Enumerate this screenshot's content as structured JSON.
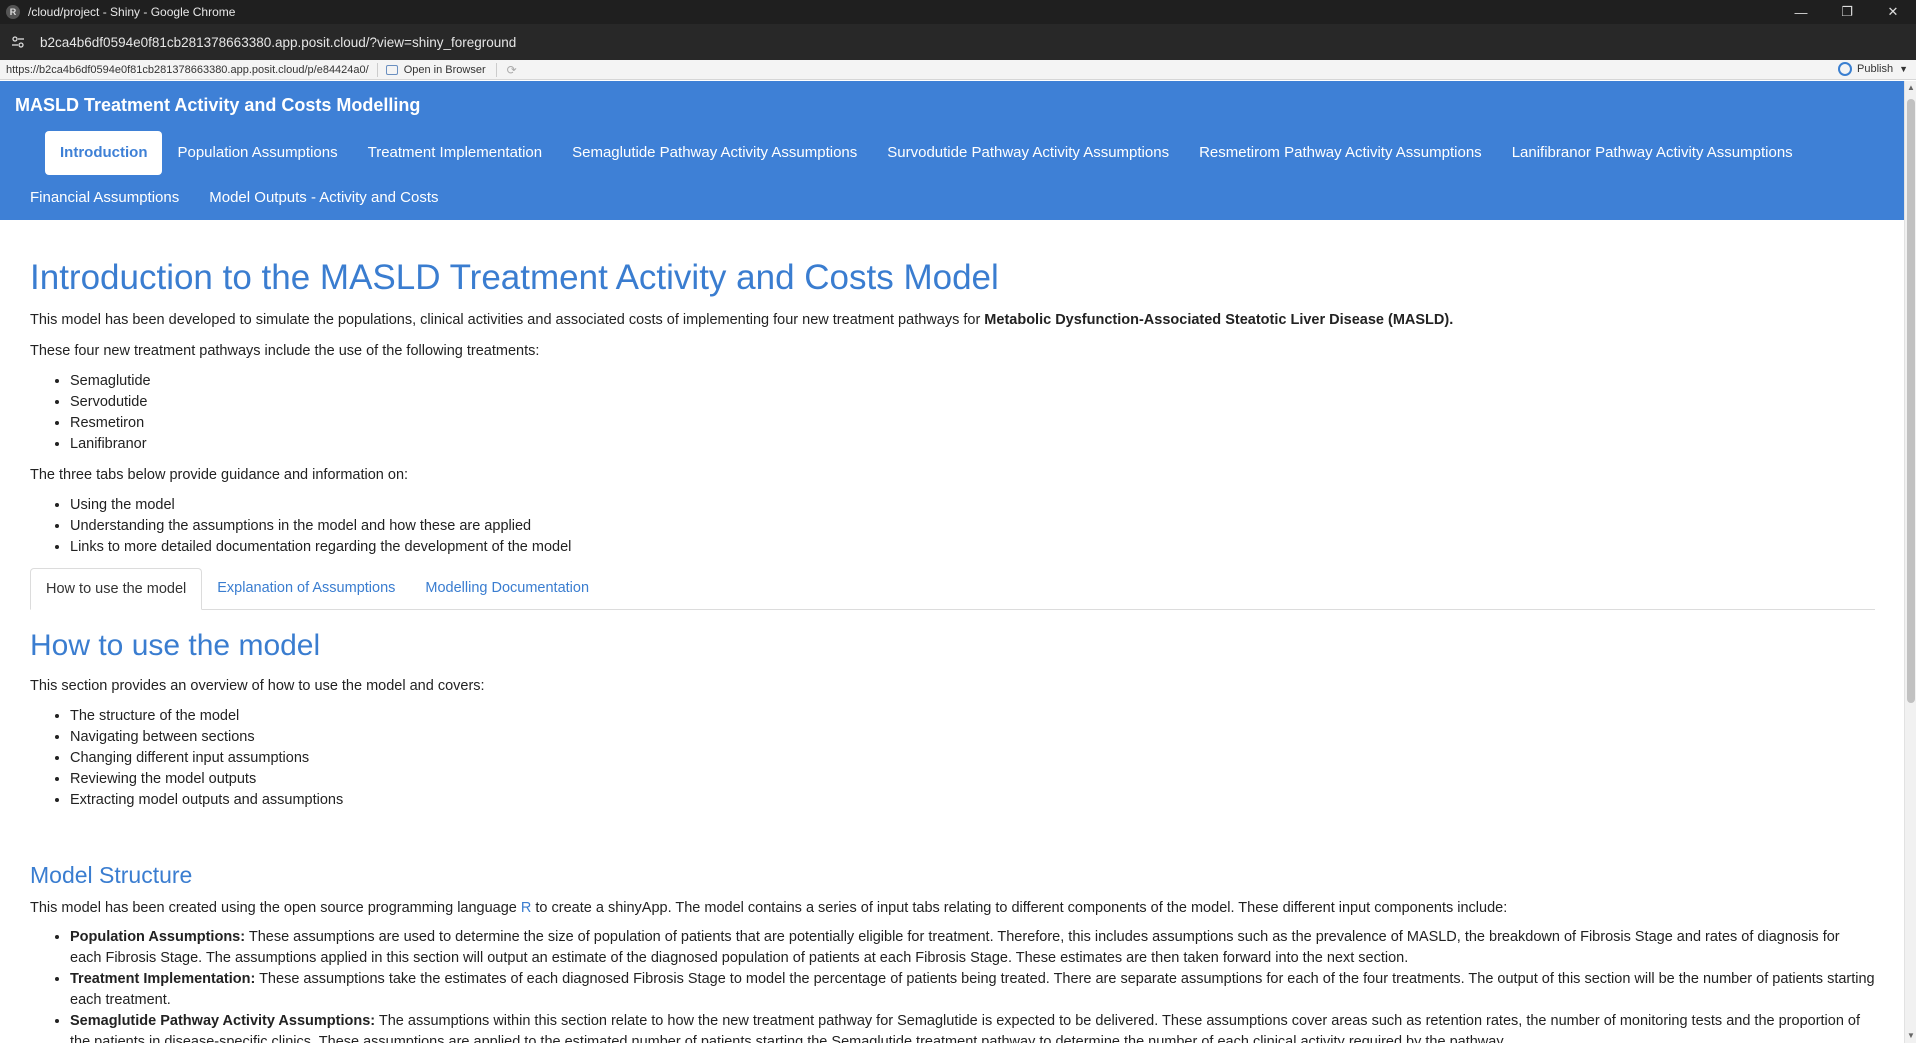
{
  "window": {
    "title": "/cloud/project - Shiny - Google Chrome",
    "controls": [
      "—",
      "❐",
      "✕"
    ]
  },
  "address": {
    "url": "b2ca4b6df0594e0f81cb281378663380.app.posit.cloud/?view=shiny_foreground"
  },
  "viewer": {
    "url": "https://b2ca4b6df0594e0f81cb281378663380.app.posit.cloud/p/e84424a0/",
    "open_in_browser": "Open in Browser",
    "publish": "Publish"
  },
  "app": {
    "brand": "MASLD Treatment Activity and Costs Modelling",
    "nav_row1": [
      {
        "label": "Introduction",
        "active": true
      },
      {
        "label": "Population Assumptions"
      },
      {
        "label": "Treatment Implementation"
      },
      {
        "label": "Semaglutide Pathway Activity Assumptions"
      },
      {
        "label": "Survodutide Pathway Activity Assumptions"
      },
      {
        "label": "Resmetirom Pathway Activity Assumptions"
      },
      {
        "label": "Lanifibranor Pathway Activity Assumptions"
      }
    ],
    "nav_row2": [
      {
        "label": "Financial Assumptions"
      },
      {
        "label": "Model Outputs - Activity and Costs"
      }
    ]
  },
  "content": {
    "title": "Introduction to the MASLD Treatment Activity and Costs Model",
    "intro_p1_text": "This model has been developed to simulate the populations, clinical activities and associated costs of implementing four new treatment pathways for ",
    "intro_p1_bold": "Metabolic Dysfunction-Associated Steatotic Liver Disease (MASLD).",
    "intro_p2": "These four new treatment pathways include the use of the following treatments:",
    "treatments": [
      "Semaglutide",
      "Servodutide",
      "Resmetiron",
      "Lanifibranor"
    ],
    "intro_p3": "The three tabs below provide guidance and information on:",
    "guidance": [
      "Using the model",
      "Understanding the assumptions in the model and how these are applied",
      "Links to more detailed documentation regarding the development of the model"
    ],
    "tabs": [
      {
        "label": "How to use the model",
        "active": true
      },
      {
        "label": "Explanation of Assumptions"
      },
      {
        "label": "Modelling Documentation"
      }
    ],
    "how_title": "How to use the model",
    "how_p": "This section provides an overview of how to use the model and covers:",
    "how_items": [
      "The structure of the model",
      "Navigating between sections",
      "Changing different input assumptions",
      "Reviewing the model outputs",
      "Extracting model outputs and assumptions"
    ],
    "structure_title": "Model Structure",
    "structure_p_pre": "This model has been created using the open source programming language ",
    "structure_p_link": "R",
    "structure_p_post": " to create a shinyApp. The model contains a series of input tabs relating to different components of the model. These different input components include:",
    "components": [
      {
        "bold": "Population Assumptions:",
        "text": " These assumptions are used to determine the size of population of patients that are potentially eligible for treatment. Therefore, this includes assumptions such as the prevalence of MASLD, the breakdown of Fibrosis Stage and rates of diagnosis for each Fibrosis Stage. The assumptions applied in this section will output an estimate of the diagnosed population of patients at each Fibrosis Stage. These estimates are then taken forward into the next section."
      },
      {
        "bold": "Treatment Implementation:",
        "text": " These assumptions take the estimates of each diagnosed Fibrosis Stage to model the percentage of patients being treated. There are separate assumptions for each of the four treatments. The output of this section will be the number of patients starting each treatment."
      },
      {
        "bold": "Semaglutide Pathway Activity Assumptions:",
        "text": " The assumptions within this section relate to how the new treatment pathway for Semaglutide is expected to be delivered. These assumptions cover areas such as retention rates, the number of monitoring tests and the proportion of the patients in disease-specific clinics. These assumptions are applied to the estimated number of patients starting the Semaglutide treatment pathway to determine the number of each clinical activity required by the pathway."
      }
    ]
  }
}
